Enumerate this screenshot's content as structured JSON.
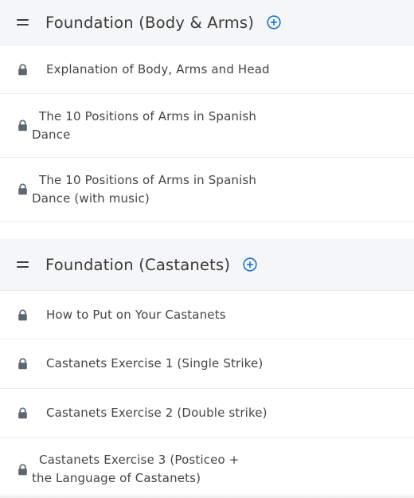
{
  "sections": [
    {
      "title": "Foundation (Body & Arms)",
      "lessons": [
        "Explanation of Body, Arms and Head",
        "The 10 Positions of Arms in Spanish Dance",
        "The 10 Positions of Arms in Spanish Dance (with music)"
      ]
    },
    {
      "title": "Foundation (Castanets)",
      "lessons": [
        "How to Put on Your Castanets",
        "Castanets Exercise 1 (Single Strike)",
        "Castanets Exercise 2 (Double strike)",
        "Castanets Exercise 3 (Posticeo + the Language of Castanets)"
      ]
    }
  ],
  "icons": {
    "drag": "drag-handle-icon",
    "add": "plus-circle-icon",
    "lock": "lock-icon"
  },
  "colors": {
    "accent": "#1a73c9",
    "header_bg": "#f5f6f7",
    "lock": "#5f6670"
  }
}
